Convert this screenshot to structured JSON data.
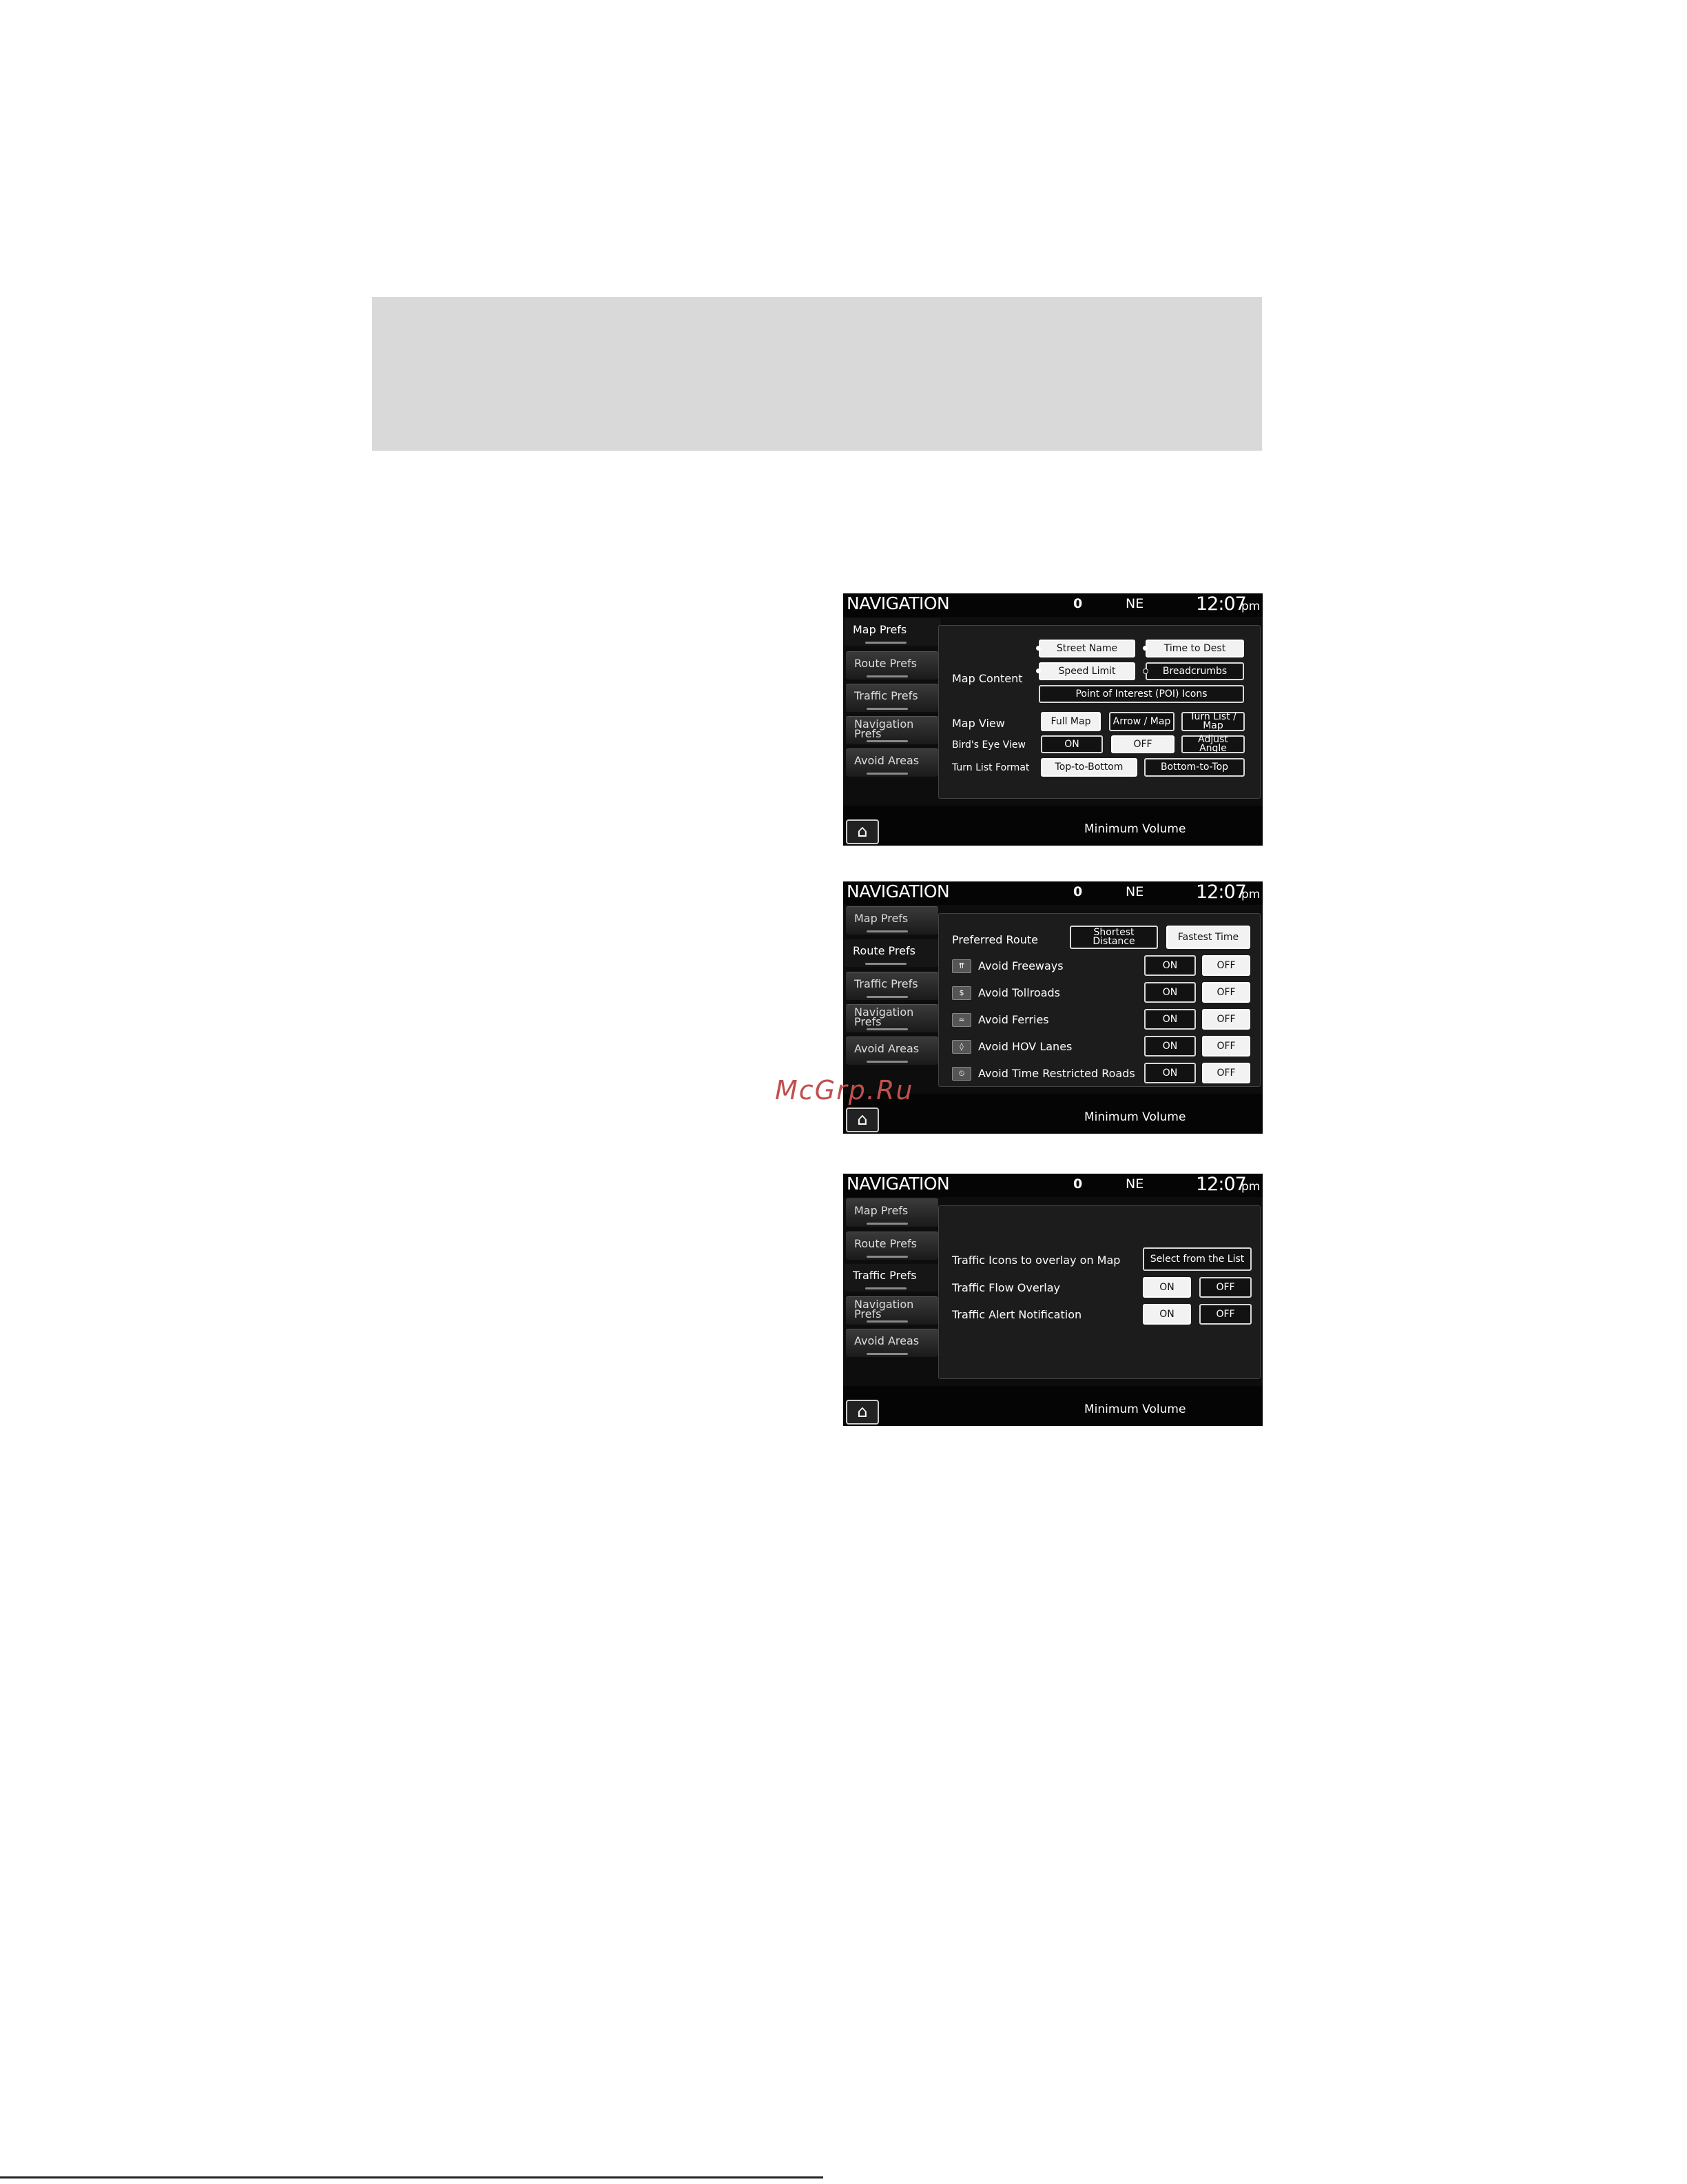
{
  "screens": [
    {
      "title": "NAVIGATION",
      "phone_indicator": "0",
      "compass": "NE",
      "time": "12:07",
      "ampm": "pm",
      "tabs": [
        "Map Prefs",
        "Route Prefs",
        "Traffic Prefs",
        "Navigation Prefs",
        "Avoid Areas"
      ],
      "active_tab": "Map Prefs",
      "labels": {
        "map_content": "Map Content",
        "map_view": "Map View",
        "birds_eye_view": "Bird's Eye View",
        "turn_list_format": "Turn List Format"
      },
      "buttons": {
        "street_name": "Street Name",
        "time_to_dest": "Time to Dest",
        "speed_limit": "Speed Limit",
        "breadcrumbs": "Breadcrumbs",
        "poi_icons": "Point of Interest (POI) Icons",
        "full_map": "Full Map",
        "arrow_map": "Arrow / Map",
        "turn_list_map": "Turn List / Map",
        "on": "ON",
        "off": "OFF",
        "adjust_angle": "Adjust Angle",
        "top_to_bottom": "Top-to-Bottom",
        "bottom_to_top": "Bottom-to-Top"
      },
      "status": "Minimum Volume",
      "home_icon": "home-icon"
    },
    {
      "title": "NAVIGATION",
      "phone_indicator": "0",
      "compass": "NE",
      "time": "12:07",
      "ampm": "pm",
      "tabs": [
        "Map Prefs",
        "Route Prefs",
        "Traffic Prefs",
        "Navigation Prefs",
        "Avoid Areas"
      ],
      "active_tab": "Route Prefs",
      "preferred_route": {
        "label": "Preferred Route",
        "shortest": "Shortest Distance",
        "fastest": "Fastest Time",
        "selected": "Fastest Time"
      },
      "avoid_rows": [
        {
          "label": "Avoid Freeways",
          "on": "ON",
          "off": "OFF",
          "icon": "freeway-icon"
        },
        {
          "label": "Avoid Tollroads",
          "on": "ON",
          "off": "OFF",
          "icon": "tollroad-icon"
        },
        {
          "label": "Avoid Ferries",
          "on": "ON",
          "off": "OFF",
          "icon": "ferry-icon"
        },
        {
          "label": "Avoid HOV Lanes",
          "on": "ON",
          "off": "OFF",
          "icon": "hov-icon"
        },
        {
          "label": "Avoid Time Restricted Roads",
          "on": "ON",
          "off": "OFF",
          "icon": "time-restricted-icon"
        }
      ],
      "status": "Minimum Volume",
      "home_icon": "home-icon"
    },
    {
      "title": "NAVIGATION",
      "phone_indicator": "0",
      "compass": "NE",
      "time": "12:07",
      "ampm": "pm",
      "tabs": [
        "Map Prefs",
        "Route Prefs",
        "Traffic Prefs",
        "Navigation Prefs",
        "Avoid Areas"
      ],
      "active_tab": "Traffic Prefs",
      "rows": {
        "overlay_label": "Traffic Icons to overlay on Map",
        "select_list": "Select from the List",
        "flow_label": "Traffic Flow Overlay",
        "alert_label": "Traffic Alert Notification",
        "on": "ON",
        "off": "OFF"
      },
      "status": "Minimum Volume",
      "home_icon": "home-icon"
    }
  ],
  "watermark": "McGrp.Ru"
}
